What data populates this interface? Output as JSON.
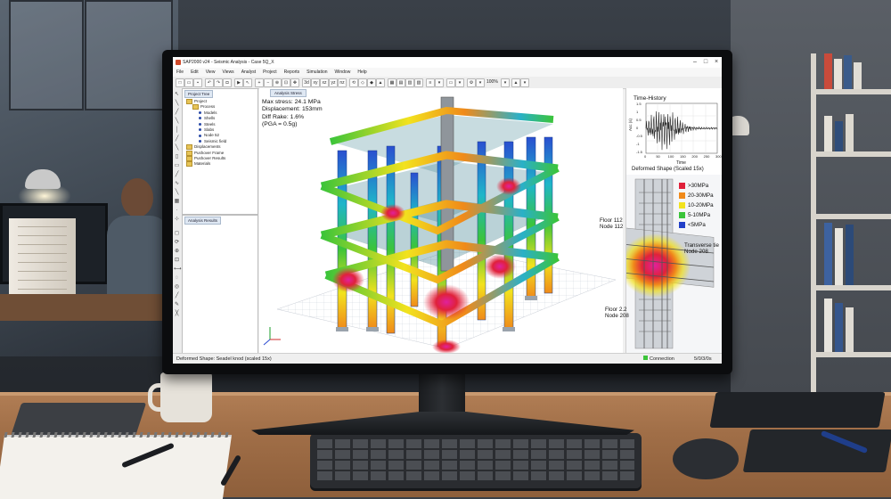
{
  "app": {
    "title": "SAP2000 v24 - Seismic Analysis - Case 5Q_X",
    "menu": [
      "File",
      "Edit",
      "View",
      "Views",
      "Analyst",
      "Project",
      "Reports",
      "Simulation",
      "Window",
      "Help"
    ],
    "zoom": "100%"
  },
  "project_tree": {
    "tab": "Project Tree",
    "items": [
      {
        "label": "Project",
        "kind": "folder",
        "level": 0
      },
      {
        "label": "Process",
        "kind": "folder",
        "level": 1
      },
      {
        "label": "Models",
        "kind": "dot",
        "level": 2
      },
      {
        "label": "Shells",
        "kind": "dot",
        "level": 2
      },
      {
        "label": "Steels",
        "kind": "dot",
        "level": 2
      },
      {
        "label": "Slabs",
        "kind": "dot",
        "level": 2
      },
      {
        "label": "Node 52",
        "kind": "dot",
        "level": 2
      },
      {
        "label": "Seismic field",
        "kind": "dot",
        "level": 2
      },
      {
        "label": "Displacements",
        "kind": "folder",
        "level": 0
      },
      {
        "label": "Pushover Frame",
        "kind": "folder",
        "level": 0
      },
      {
        "label": "Pushover Results",
        "kind": "folder",
        "level": 0
      },
      {
        "label": "Materials",
        "kind": "folder",
        "level": 0
      }
    ]
  },
  "analysis_results": {
    "tab": "Analysis Results"
  },
  "viewport": {
    "tab": "Analysis Stress",
    "max_stress": "Max stress: 24.1 MPa",
    "displacement": "Displacement: 153mm",
    "drift": "Diff Rake: 1.6%",
    "pga": "(PGA = 0.5g)"
  },
  "time_history": {
    "title": "Time-History",
    "ylabel": "Acc (s)",
    "xlabel": "Time",
    "x_ticks": [
      "0",
      "50",
      "100",
      "150",
      "200",
      "250",
      "300"
    ],
    "y_ticks": [
      "1.5",
      "1",
      "0.5",
      "0",
      "-0.5",
      "-1",
      "-1.5"
    ],
    "caption": "Deformed Shape (Scaled 15x)"
  },
  "legend": {
    "items": [
      {
        "label": ">30MPa",
        "color": "#e0213a"
      },
      {
        "label": "20-30MPa",
        "color": "#f08a1a"
      },
      {
        "label": "10-20MPa",
        "color": "#f2e21e"
      },
      {
        "label": "5-10MPa",
        "color": "#3bc43a"
      },
      {
        "label": "<5MPa",
        "color": "#2240c8"
      }
    ]
  },
  "callouts": {
    "floor112": "Floor 112",
    "node112": "Node 112",
    "transverse": "Transverse tie",
    "node208a": "Node 208",
    "floor22": "Floor 2.2",
    "node208b": "Node 208"
  },
  "status": {
    "left": "Deformed Shape: Seadel knod (scaled 15x)",
    "connection": "Connection",
    "right": "5/0/3/0s"
  },
  "colors": {
    "accent": "#2b6fb8",
    "stress_high": "#e0213a",
    "stress_low": "#2240c8"
  }
}
